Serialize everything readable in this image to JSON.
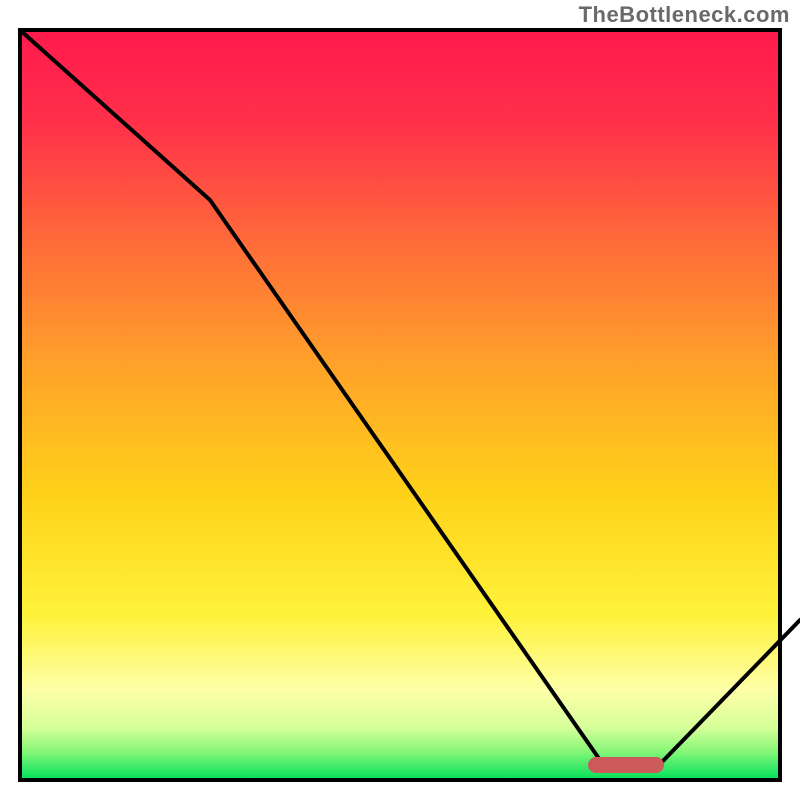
{
  "watermark": "TheBottleneck.com",
  "colors": {
    "gradient_top": "#ff1a4d",
    "gradient_mid1": "#ff6a3a",
    "gradient_mid2": "#ffd21a",
    "gradient_mid3": "#feffa8",
    "gradient_bottom": "#00e05a",
    "curve": "#000000",
    "marker": "#cc5a5a",
    "border": "#000000"
  },
  "chart_data": {
    "type": "line",
    "title": "",
    "xlabel": "",
    "ylabel": "",
    "xlim": [
      0,
      1
    ],
    "ylim": [
      0,
      1
    ],
    "grid": false,
    "legend": false,
    "series": [
      {
        "name": "bottleneck-curve",
        "x": [
          0.0,
          0.25,
          0.76,
          0.84,
          1.0
        ],
        "values": [
          1.0,
          0.77,
          0.02,
          0.02,
          0.21
        ]
      }
    ],
    "annotations": [
      {
        "name": "optimal-range-marker",
        "shape": "pill",
        "x_range": [
          0.75,
          0.85
        ],
        "y": 0.02,
        "color": "#cc5a5a"
      }
    ],
    "background_gradient": {
      "direction": "vertical",
      "stops": [
        {
          "offset": 0.0,
          "color": "#ff1a4d"
        },
        {
          "offset": 0.28,
          "color": "#ff6a3a"
        },
        {
          "offset": 0.62,
          "color": "#ffd21a"
        },
        {
          "offset": 0.88,
          "color": "#feffa8"
        },
        {
          "offset": 1.0,
          "color": "#00e05a"
        }
      ]
    }
  }
}
